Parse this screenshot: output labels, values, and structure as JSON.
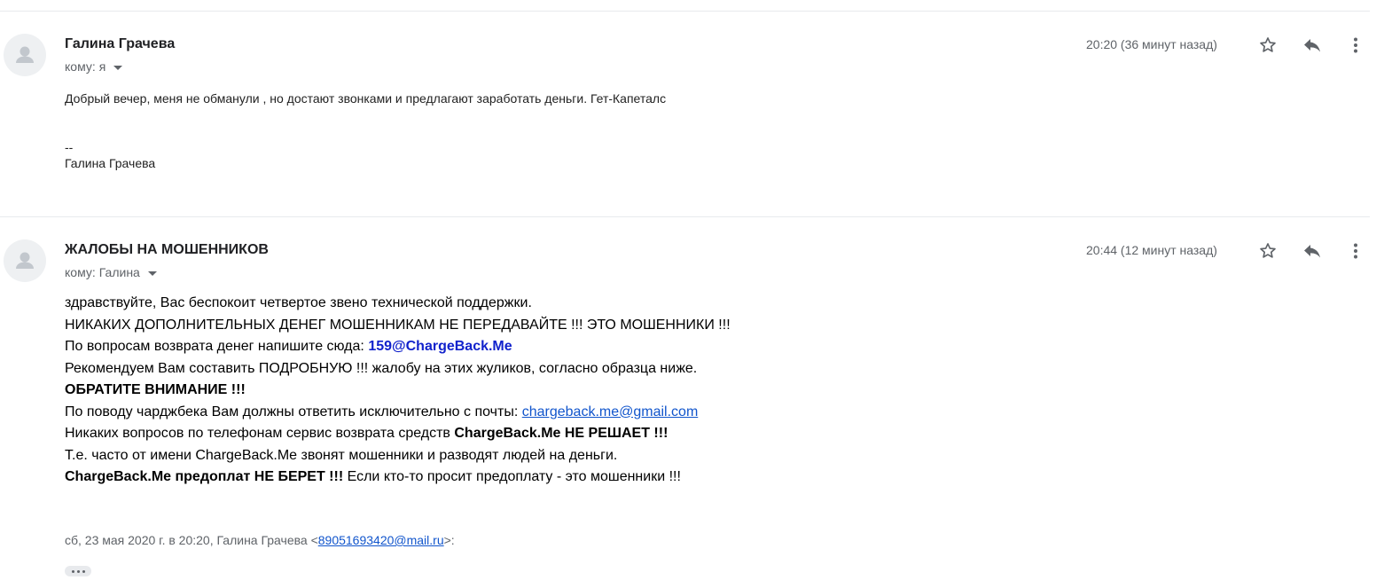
{
  "messages": [
    {
      "sender": "Галина Грачева",
      "to_label": "кому:",
      "to_value": "я",
      "time": "20:20 (36 минут назад)",
      "body_lines": [
        "Добрый вечер, меня не обманули , но достают звонками и предлагают заработать деньги. Гет-Капеталс",
        "--",
        "Галина Грачева"
      ]
    },
    {
      "sender": "ЖАЛОБЫ НА МОШЕННИКОВ",
      "to_label": "кому:",
      "to_value": "Галина",
      "time": "20:44 (12 минут назад)",
      "body": {
        "line1": "здравствуйте, Вас беспокоит четвертое звено технической поддержки.",
        "line2": "НИКАКИХ ДОПОЛНИТЕЛЬНЫХ ДЕНЕГ МОШЕННИКАМ НЕ ПЕРЕДАВАЙТЕ !!! ЭТО МОШЕННИКИ !!!",
        "line3_text": "По вопросам возврата денег напишите сюда: ",
        "line3_email": "159@ChargeBack.Me",
        "line4": "Рекомендуем Вам составить ПОДРОБНУЮ !!! жалобу на этих жуликов, согласно образца ниже.",
        "line5": "ОБРАТИТЕ ВНИМАНИЕ !!!",
        "line6_text": "По поводу чарджбека Вам должны ответить исключительно с почты: ",
        "line6_link": "chargeback.me@gmail.com",
        "line7_text": "Никаких вопросов по телефонам сервис возврата средств ",
        "line7_bold": "ChargeBack.Me НЕ РЕШАЕТ !!!",
        "line8": "Т.е. часто от имени ChargeBack.Me звонят мошенники и разводят людей на деньги.",
        "line9_bold": "ChargeBack.Me предоплат НЕ БЕРЕТ !!!",
        "line9_text": " Если кто-то просит предоплату - это мошенники !!!"
      },
      "quote_header_prefix": "сб, 23 мая 2020 г. в 20:20, Галина Грачева <",
      "quote_header_email": "89051693420@mail.ru",
      "quote_header_suffix": ">:"
    }
  ],
  "icons": {
    "avatar": "person-icon",
    "star": "star-icon",
    "reply": "reply-icon",
    "more": "more-vert-icon",
    "expand": "ellipsis-icon"
  },
  "colors": {
    "secondary_text": "#5f6368",
    "link": "#1155cc",
    "bold_email": "#1122cc",
    "divider": "#e8eaed",
    "avatar_bg": "#eef0f2"
  }
}
